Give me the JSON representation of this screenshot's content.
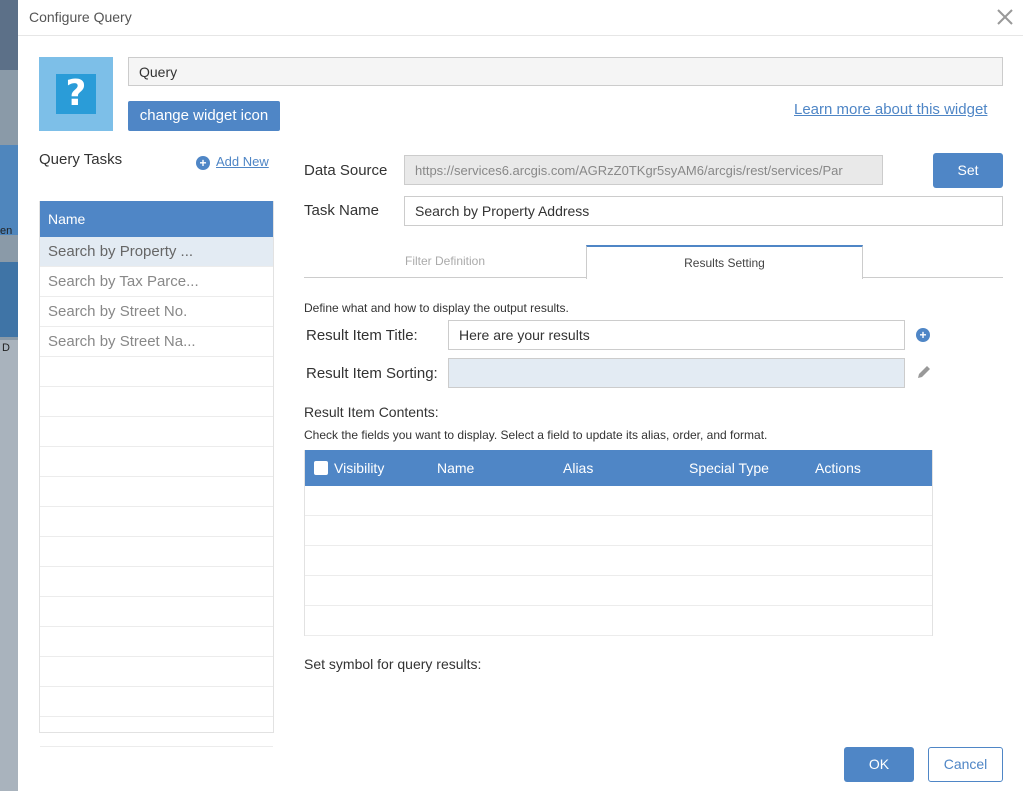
{
  "background": {
    "fragment_1": "en",
    "fragment_2": "D"
  },
  "dialog": {
    "title": "Configure Query",
    "close_icon": "close-icon"
  },
  "widget": {
    "icon": "question-mark-icon",
    "icon_glyph": "?",
    "name_value": "Query",
    "change_icon_label": "change widget icon",
    "learn_more_label": "Learn more about this widget"
  },
  "tasks": {
    "label": "Query Tasks",
    "add_new_label": "Add New",
    "add_icon": "plus-circle-icon",
    "column_header": "Name",
    "items": [
      {
        "label": "Search by Property ..."
      },
      {
        "label": "Search by Tax Parce..."
      },
      {
        "label": "Search by Street No."
      },
      {
        "label": "Search by Street Na..."
      }
    ],
    "selected_index": 0
  },
  "form": {
    "data_source_label": "Data Source",
    "data_source_value": "https://services6.arcgis.com/AGRzZ0TKgr5syAM6/arcgis/rest/services/Par",
    "set_label": "Set",
    "task_name_label": "Task Name",
    "task_name_value": "Search by Property Address"
  },
  "tabs": [
    {
      "label": "Filter Definition",
      "active": false
    },
    {
      "label": "Results Setting",
      "active": true
    }
  ],
  "results": {
    "description": "Define what and how to display the output results.",
    "item_title_label": "Result Item Title:",
    "item_title_value": "Here are your results",
    "item_sorting_label": "Result Item Sorting:",
    "item_sorting_value": "",
    "item_contents_label": "Result Item Contents:",
    "check_fields_text": "Check the fields you want to display. Select a field to update its alias, order, and format.",
    "columns": [
      "Visibility",
      "Name",
      "Alias",
      "Special Type",
      "Actions"
    ],
    "symbol_label": "Set symbol for query results:"
  },
  "footer": {
    "ok_label": "OK",
    "cancel_label": "Cancel"
  },
  "colors": {
    "accent": "#4f86c6",
    "selected_row": "#e3ebf3",
    "icon_bg": "#7dbfe8",
    "icon_inner": "#2a9cd8"
  }
}
